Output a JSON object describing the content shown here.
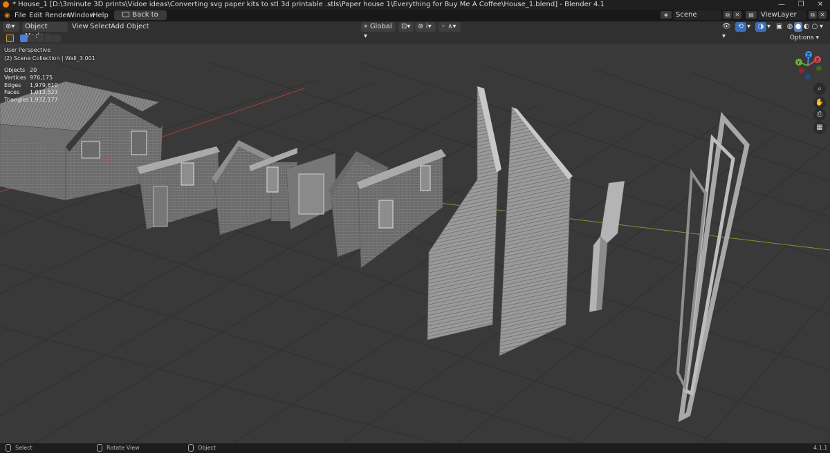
{
  "window": {
    "title": "* House_1 [D:\\3minute 3D prints\\Vidoe ideas\\Converting svg paper kits to stl 3d printable .stls\\Paper house 1\\Everything for Buy Me A Coffee\\House_1.blend] - Blender 4.1",
    "controls": [
      "—",
      "❐",
      "✕"
    ]
  },
  "menu": {
    "items": [
      "File",
      "Edit",
      "Render",
      "Window",
      "Help"
    ],
    "back_button": "Back to Previous",
    "scene_label": "Scene",
    "viewlayer_label": "ViewLayer"
  },
  "header": {
    "mode": "Object Mode",
    "menus": [
      "View",
      "Select",
      "Add",
      "Object"
    ],
    "transform_orientation": "Global",
    "options": "Options"
  },
  "viewport": {
    "perspective": "User Perspective",
    "collection": "(2) Scene Collection | Wall_3.001",
    "stats": [
      {
        "label": "Objects",
        "value": "20"
      },
      {
        "label": "Vertices",
        "value": "976,175"
      },
      {
        "label": "Edges",
        "value": "1,979,610"
      },
      {
        "label": "Faces",
        "value": "1,013,523"
      },
      {
        "label": "Triangles",
        "value": "1,932,177"
      }
    ],
    "gizmo": {
      "x": "X",
      "y": "Y",
      "z": "Z"
    }
  },
  "statusbar": {
    "items": [
      "Select",
      "Rotate View",
      "Object"
    ],
    "version": "4.1.1"
  },
  "colors": {
    "background": "#393939",
    "x_axis": "#b33a3a",
    "y_axis": "#6ea02c",
    "gizmo_x": "#e0444f",
    "gizmo_y": "#6bb12a",
    "gizmo_z": "#3d8fe0"
  }
}
